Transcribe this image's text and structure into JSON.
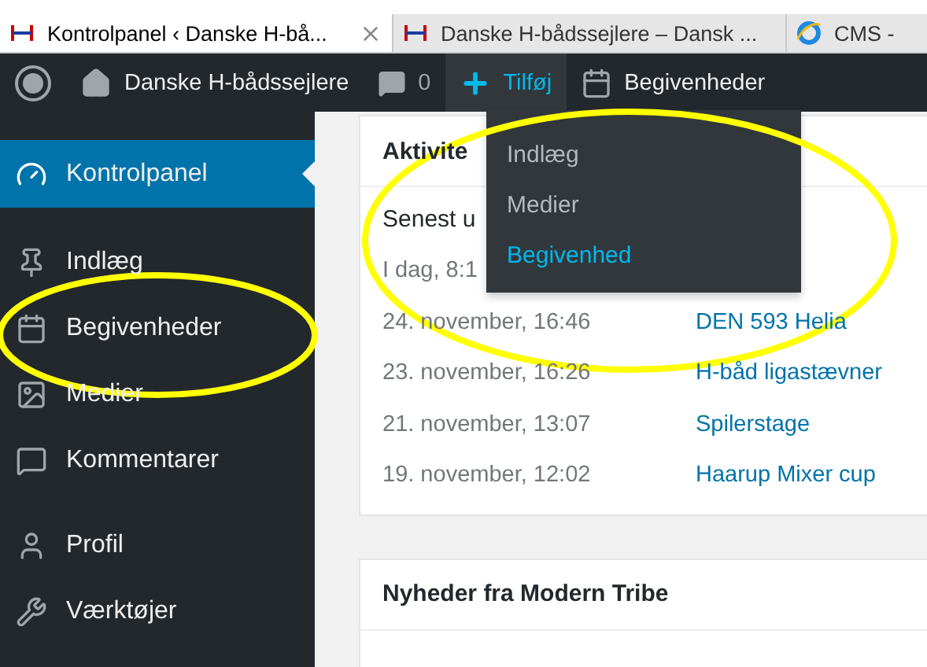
{
  "browser_tabs": [
    {
      "kind": "site",
      "title": "Kontrolpanel ‹ Danske H-bå...",
      "selected": true,
      "closable": true
    },
    {
      "kind": "site",
      "title": "Danske H-bådssejlere – Dansk ...",
      "selected": false,
      "closable": false
    },
    {
      "kind": "ie",
      "title": "CMS -",
      "selected": false,
      "closable": false
    }
  ],
  "admin_bar": {
    "site_name": "Danske H-bådssejlere",
    "comments_count": "0",
    "new_label": "Tilføj",
    "new_open": true,
    "events_label": "Begivenheder"
  },
  "new_menu": {
    "items": [
      {
        "label": "Indlæg",
        "selected": false
      },
      {
        "label": "Medier",
        "selected": false
      },
      {
        "label": "Begivenhed",
        "selected": true
      }
    ]
  },
  "sidebar": {
    "groups": [
      [
        {
          "label": "Kontrolpanel",
          "selected": true
        }
      ],
      [
        {
          "label": "Indlæg",
          "selected": false
        },
        {
          "label": "Begivenheder",
          "selected": false
        },
        {
          "label": "Medier",
          "selected": false
        },
        {
          "label": "Kommentarer",
          "selected": false
        }
      ],
      [
        {
          "label": "Profil",
          "selected": false
        },
        {
          "label": "Værktøjer",
          "selected": false
        }
      ]
    ]
  },
  "activity": {
    "title": "Aktivite",
    "subtitle": "Senest u",
    "rows": [
      {
        "date": "I dag, 8:1"
      },
      {
        "date": "24. november, 16:46",
        "title": "DEN 593 Helia"
      },
      {
        "date": "23. november, 16:26",
        "title": "H-båd ligastævner"
      },
      {
        "date": "21. november, 13:07",
        "title": "Spilerstage"
      },
      {
        "date": "19. november, 12:02",
        "title": "Haarup Mixer cup"
      }
    ]
  },
  "news": {
    "title": "Nyheder fra Modern Tribe"
  },
  "annotations": [
    {
      "kind": "ellipse"
    },
    {
      "kind": "ellipse"
    }
  ]
}
